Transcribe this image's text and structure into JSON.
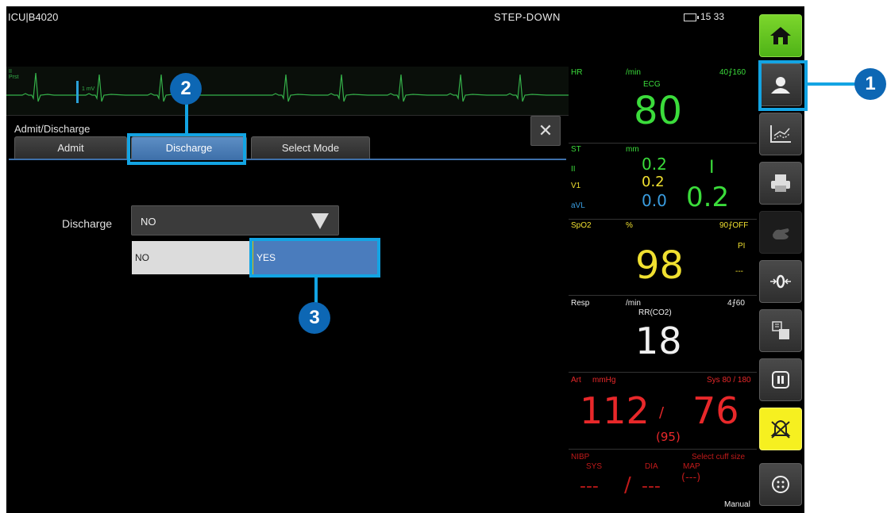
{
  "topbar": {
    "unit_bed": "ICU|B4020",
    "mode": "STEP-DOWN",
    "clock": "15 33"
  },
  "ecg": {
    "lead": "II",
    "lead_sub": "Prst",
    "scale": "1 mV"
  },
  "panel": {
    "title": "Admit/Discharge",
    "tabs": [
      "Admit",
      "Discharge",
      "Select Mode"
    ],
    "active_tab": "Discharge",
    "close_symbol": "✕"
  },
  "discharge": {
    "label": "Discharge",
    "value": "NO",
    "options": [
      "NO",
      "YES"
    ],
    "highlighted_option": "YES"
  },
  "vitals": {
    "hr": {
      "label": "HR",
      "unit": "/min",
      "limits": "40⨍160",
      "source": "ECG",
      "value": "80"
    },
    "st": {
      "label": "ST",
      "unit": "mm",
      "leads": [
        "II",
        "V1",
        "aVL"
      ],
      "values": [
        "0.2",
        "0.2",
        "0.0"
      ],
      "marker": "I",
      "big_value": "0.2"
    },
    "spo2": {
      "label": "SpO2",
      "unit": "%",
      "limits": "90⨍OFF",
      "pi_label": "PI",
      "pi_value": "---",
      "value": "98"
    },
    "resp": {
      "label": "Resp",
      "unit": "/min",
      "limits": "4⨍60",
      "source": "RR(CO2)",
      "value": "18"
    },
    "art": {
      "label": "Art",
      "unit": "mmHg",
      "limits": "Sys 80 / 180",
      "sys": "112",
      "sep": "/",
      "dia": "76",
      "map": "(95)"
    },
    "nibp": {
      "label": "NIBP",
      "note": "Select cuff size",
      "col_sys": "SYS",
      "col_dia": "DIA",
      "col_map": "MAP",
      "sys": "---",
      "sep": "/",
      "dia": "---",
      "map": "(---)",
      "mode": "Manual"
    }
  },
  "sidebar": {
    "buttons": [
      "home-icon",
      "patient-icon",
      "trends-icon",
      "printer-icon",
      "hand-icon",
      "zero-icon",
      "layout-icon",
      "pause-icon",
      "alarm-silence-icon",
      "menu-icon"
    ]
  },
  "callouts": [
    "1",
    "2",
    "3"
  ],
  "colors": {
    "callout": "#0d67b4",
    "highlight": "#13a4e3",
    "hr_green": "#3bdc3b",
    "spo2_yellow": "#f0e030",
    "art_red": "#e8282a",
    "home_green": "#6bcc25",
    "alarm_yellow": "#f6f020"
  }
}
